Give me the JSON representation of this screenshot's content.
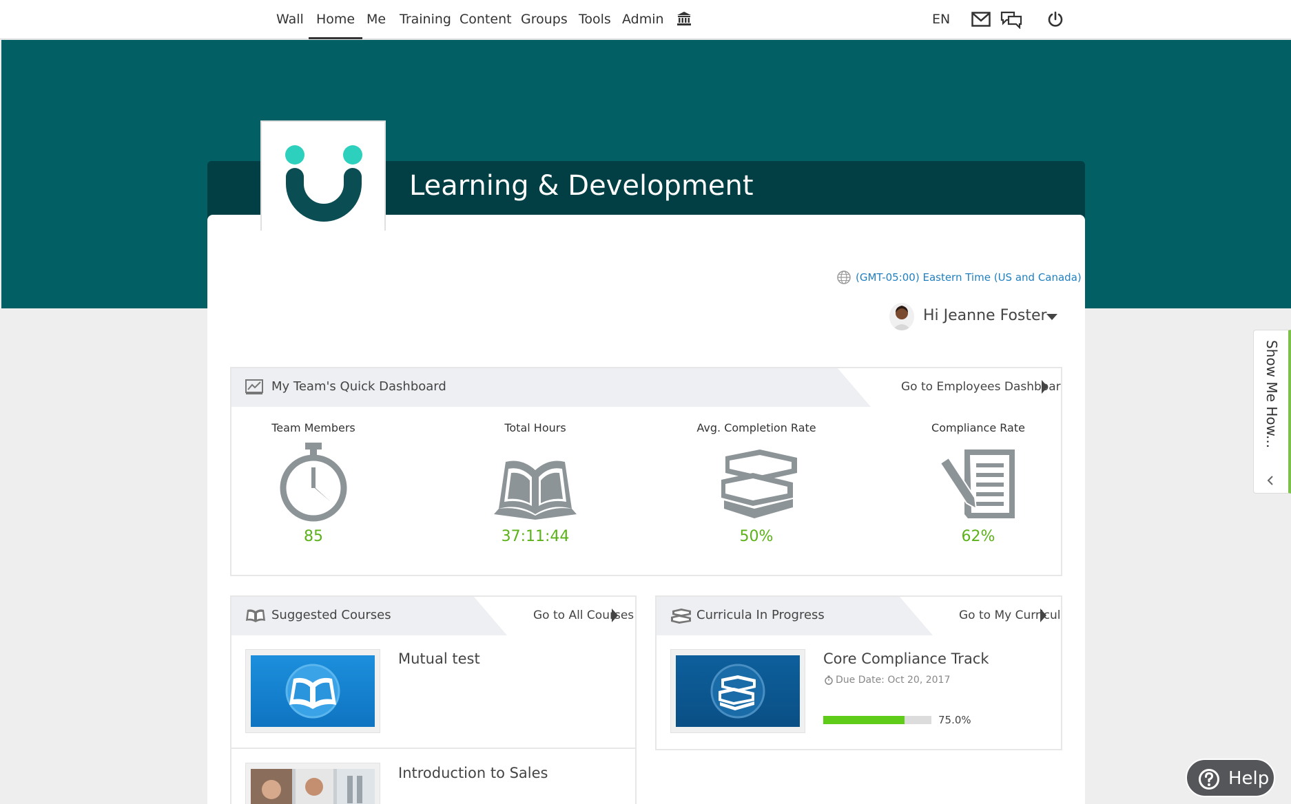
{
  "nav": {
    "items": [
      "Wall",
      "Home",
      "Me",
      "Training",
      "Content",
      "Groups",
      "Tools",
      "Admin"
    ],
    "active": "Home",
    "language": "EN",
    "icons": [
      "institution-icon",
      "mail-icon",
      "chat-icon",
      "power-icon"
    ]
  },
  "header": {
    "title": "Learning & Development",
    "timezone": "(GMT-05:00) Eastern Time (US and Canada)",
    "greeting": "Hi Jeanne Foster"
  },
  "colors": {
    "banner": "#025f64",
    "title_bar": "#023f44",
    "accent_green": "#5bb218",
    "link_blue": "#1f7fbf",
    "logo_teal": "#2dd0bd",
    "logo_dark": "#0a4d53"
  },
  "dashboard": {
    "title": "My Team's Quick Dashboard",
    "link": "Go to Employees Dashboard",
    "stats": [
      {
        "label": "Team Members",
        "value": "85",
        "icon": "stopwatch-icon"
      },
      {
        "label": "Total Hours",
        "value": "37:11:44",
        "icon": "open-book-icon"
      },
      {
        "label": "Avg. Completion Rate",
        "value": "50%",
        "icon": "books-stack-icon"
      },
      {
        "label": "Compliance Rate",
        "value": "62%",
        "icon": "document-pen-icon"
      }
    ]
  },
  "suggested": {
    "title": "Suggested Courses",
    "link": "Go to All Courses",
    "courses": [
      {
        "title": "Mutual test",
        "thumb": "open-book-thumbnail"
      },
      {
        "title": "Introduction to Sales",
        "thumb": "photo-thumbnail"
      }
    ]
  },
  "curricula": {
    "title": "Curricula In Progress",
    "link": "Go to My Curricula",
    "items": [
      {
        "title": "Core Compliance Track",
        "due": "Due Date: Oct 20, 2017",
        "progress_label": "75.0%",
        "progress": 0.75
      }
    ]
  },
  "show_me_how": "Show Me How...",
  "help": "Help"
}
